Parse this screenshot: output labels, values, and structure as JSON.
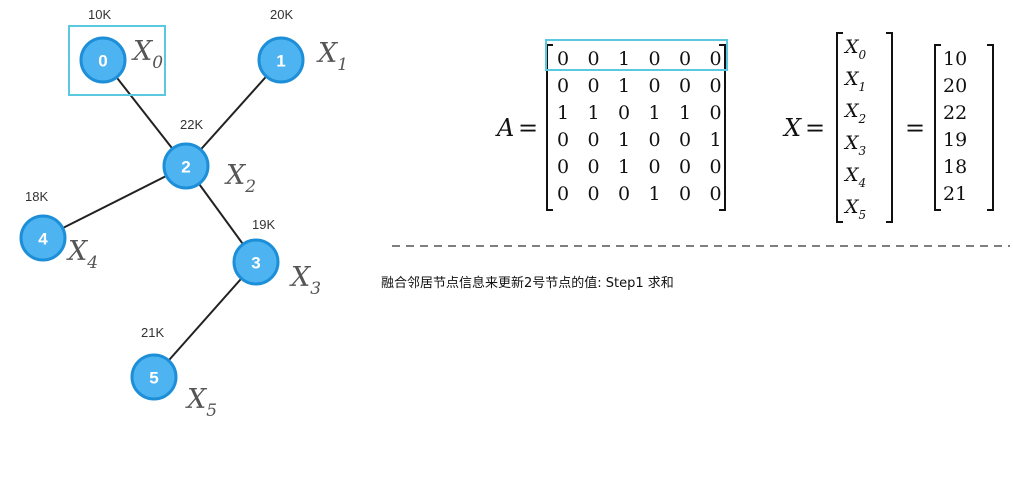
{
  "graph": {
    "nodes": [
      {
        "id": "0",
        "value": "10K",
        "var": "X",
        "sub": "0"
      },
      {
        "id": "1",
        "value": "20K",
        "var": "X",
        "sub": "1"
      },
      {
        "id": "2",
        "value": "22K",
        "var": "X",
        "sub": "2"
      },
      {
        "id": "3",
        "value": "19K",
        "var": "X",
        "sub": "3"
      },
      {
        "id": "4",
        "value": "18K",
        "var": "X",
        "sub": "4"
      },
      {
        "id": "5",
        "value": "21K",
        "var": "X",
        "sub": "5"
      }
    ],
    "edges": [
      [
        "0",
        "2"
      ],
      [
        "1",
        "2"
      ],
      [
        "2",
        "4"
      ],
      [
        "2",
        "3"
      ],
      [
        "3",
        "5"
      ]
    ],
    "highlight_node": "0",
    "node_color": "#4eb3f1",
    "node_border_color": "#1d8fd8",
    "highlight_color": "#5ac8e0"
  },
  "matrix": {
    "name": "A",
    "equals": "=",
    "rows": [
      [
        "0",
        "0",
        "1",
        "0",
        "0",
        "0"
      ],
      [
        "0",
        "0",
        "1",
        "0",
        "0",
        "0"
      ],
      [
        "1",
        "1",
        "0",
        "1",
        "1",
        "0"
      ],
      [
        "0",
        "0",
        "1",
        "0",
        "0",
        "1"
      ],
      [
        "0",
        "0",
        "1",
        "0",
        "0",
        "0"
      ],
      [
        "0",
        "0",
        "0",
        "1",
        "0",
        "0"
      ]
    ],
    "highlight_row": 0
  },
  "features": {
    "name": "X",
    "equals_1": "=",
    "equals_2": "=",
    "vars": [
      {
        "var": "X",
        "sub": "0"
      },
      {
        "var": "X",
        "sub": "1"
      },
      {
        "var": "X",
        "sub": "2"
      },
      {
        "var": "X",
        "sub": "3"
      },
      {
        "var": "X",
        "sub": "4"
      },
      {
        "var": "X",
        "sub": "5"
      }
    ],
    "values": [
      "10",
      "20",
      "22",
      "19",
      "18",
      "21"
    ]
  },
  "caption": "融合邻居节点信息来更新2号节点的值: Step1 求和"
}
